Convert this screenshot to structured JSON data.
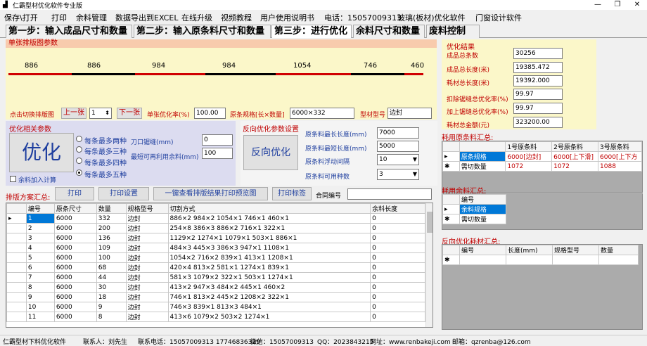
{
  "window": {
    "title": "仁霸型材优化软件专业版"
  },
  "menu": [
    "保存\\打开",
    "打印",
    "余料管理",
    "数据导出到EXCEL",
    "在线升级",
    "视频教程",
    "用户使用说明书",
    "电话：15057009313",
    "玻璃(板材)优化软件",
    "门窗设计软件"
  ],
  "tabs": [
    "第一步：输入成品尺寸和数量",
    "第二步：输入原条料尺寸和数量",
    "第三步：进行优化",
    "余料尺寸和数量",
    "废料控制"
  ],
  "layout_panel": {
    "title": "单张排版图参数",
    "segments": [
      {
        "label": "886",
        "color": "#d00000"
      },
      {
        "label": "886",
        "color": "#000000"
      },
      {
        "label": "984",
        "color": "#d00000"
      },
      {
        "label": "984",
        "color": "#000000"
      },
      {
        "label": "1054",
        "color": "#d00000"
      },
      {
        "label": "746",
        "color": "#000000"
      },
      {
        "label": "460",
        "color": "#d00000"
      }
    ],
    "switch_label": "点击切换排版图",
    "prev_btn": "上一张",
    "page_value": "1",
    "next_btn": "下一张",
    "rate_label": "单张优化率(%)",
    "rate_value": "100.00",
    "spec_label": "原条规格[长×数量]",
    "spec_value": "6000×332",
    "model_label": "型材型号",
    "model_value": "边封"
  },
  "results": {
    "title": "优化结果",
    "rows": [
      {
        "label": "成品总条数",
        "value": "30256"
      },
      {
        "label": "成品总长度(米)",
        "value": "19385.472"
      },
      {
        "label": "耗材总长度(米)",
        "value": "19392.000"
      },
      {
        "label": "扣除锯缝总优化率(%)",
        "value": "99.97"
      },
      {
        "label": "加上锯缝总优化率(%)",
        "value": "99.97"
      },
      {
        "label": "耗材总金额(元)",
        "value": "323200.00"
      }
    ]
  },
  "opt_params": {
    "title": "优化相关参数",
    "optimize_btn": "优化",
    "radios": [
      "每条最多两种",
      "每条最多三种",
      "每条最多四种",
      "每条最多五种"
    ],
    "selected_radio": 3,
    "saw_label": "刀口锯缝(mm)",
    "saw_value": "0",
    "min_label": "最短可再利用余料(mm)",
    "min_value": "100",
    "checkbox_label": "余料加入计算"
  },
  "reverse_params": {
    "title": "反向优化参数设置",
    "btn": "反向优化",
    "rows": [
      {
        "label": "原条料最长长度(mm)",
        "value": "7000"
      },
      {
        "label": "原条料最短长度(mm)",
        "value": "5000"
      },
      {
        "label": "原条料浮动间隔",
        "value": "10"
      },
      {
        "label": "原条料可用种数",
        "value": "3"
      }
    ]
  },
  "plan": {
    "title": "排版方案汇总:",
    "print_btn": "打印",
    "print_settings_btn": "打印设置",
    "preview_btn": "一键查看排版结果打印预览图",
    "label_btn": "打印标签",
    "contract_label": "合同编号",
    "contract_value": "",
    "columns": [
      "编号",
      "原条尺寸",
      "数量",
      "规格型号",
      "切割方式",
      "余料长度"
    ],
    "rows": [
      [
        "1",
        "6000",
        "332",
        "边封",
        "886×2 984×2 1054×1 746×1 460×1",
        "0"
      ],
      [
        "2",
        "6000",
        "200",
        "边封",
        "254×8 386×3 886×2 716×1 322×1",
        "0"
      ],
      [
        "3",
        "6000",
        "136",
        "边封",
        "1129×2 1274×1 1079×1 503×1 886×1",
        "0"
      ],
      [
        "4",
        "6000",
        "109",
        "边封",
        "484×3 445×3 386×3 947×1 1108×1",
        "0"
      ],
      [
        "5",
        "6000",
        "100",
        "边封",
        "1054×2 716×2 839×1 413×1 1208×1",
        "0"
      ],
      [
        "6",
        "6000",
        "68",
        "边封",
        "420×4 813×2 581×1 1274×1 839×1",
        "0"
      ],
      [
        "7",
        "6000",
        "44",
        "边封",
        "581×3 1079×2 322×1 503×1 1274×1",
        "0"
      ],
      [
        "8",
        "6000",
        "30",
        "边封",
        "413×2 947×3 484×2 445×1 460×2",
        "0"
      ],
      [
        "9",
        "6000",
        "18",
        "边封",
        "746×1 813×2 445×2 1208×2 322×1",
        "0"
      ],
      [
        "10",
        "6000",
        "9",
        "边封",
        "746×3 839×1 813×3 484×1",
        "0"
      ],
      [
        "11",
        "6000",
        "8",
        "边封",
        "413×6 1079×2 503×2 1274×1",
        "0"
      ]
    ]
  },
  "consumed": {
    "title": "耗用原条料汇总:",
    "headers": [
      "",
      "1号原条料",
      "2号原条料",
      "3号原条料"
    ],
    "rows": [
      {
        "label": "原条规格",
        "cells": [
          "6000[边封]",
          "6000[上下滑]",
          "6000[上下方"
        ]
      },
      {
        "label": "需切数量",
        "cells": [
          "1072",
          "1072",
          "1088"
        ]
      }
    ]
  },
  "consumed_remnant": {
    "title": "耗用余料汇总:",
    "headers": [
      "编号"
    ],
    "rows": [
      "余料规格",
      "需切数量"
    ]
  },
  "reverse_summary": {
    "title": "反向优化耗材汇总:",
    "columns": [
      "编号",
      "长度(mm)",
      "规格型号",
      "数量"
    ]
  },
  "status": [
    "仁霸型材下料优化软件",
    "联系人：刘先生",
    "联系电话：15057009313 17746836329",
    "微信：15057009313",
    "QQ：2023843215",
    "网址：www.renbakeji.com",
    "邮箱：qzrenba@126.com"
  ]
}
